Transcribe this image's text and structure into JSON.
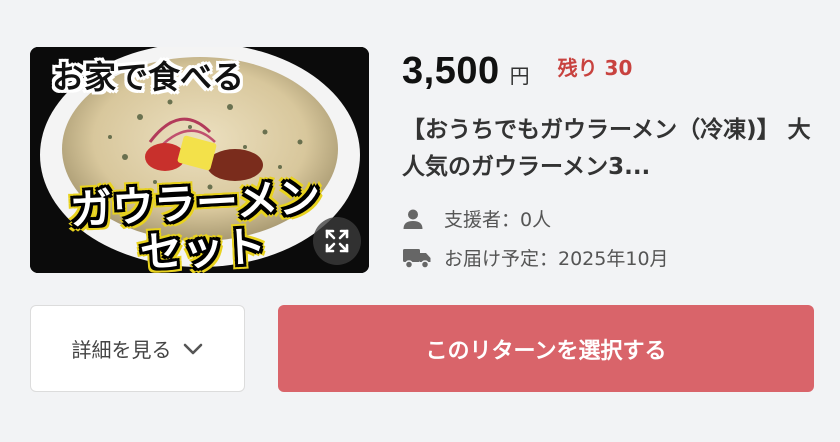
{
  "thumbnail": {
    "caption_line1": "お家で食べる",
    "caption_line2": "ガウラーメン",
    "caption_line3": "セット",
    "expand_icon": "expand-arrows-icon"
  },
  "price": {
    "amount": "3,500",
    "currency": "円",
    "remaining": "残り 30"
  },
  "title": "【おうちでもガウラーメン（冷凍)】 大人気のガウラーメン3...",
  "supporters": {
    "icon": "person-icon",
    "text": "支援者：0人"
  },
  "delivery": {
    "icon": "truck-icon",
    "text": "お届け予定：2025年10月"
  },
  "buttons": {
    "details_label": "詳細を見る",
    "select_label": "このリターンを選択する"
  },
  "colors": {
    "accent": "#d9646a",
    "remaining": "#c8423f",
    "background": "#f2f3f5"
  }
}
